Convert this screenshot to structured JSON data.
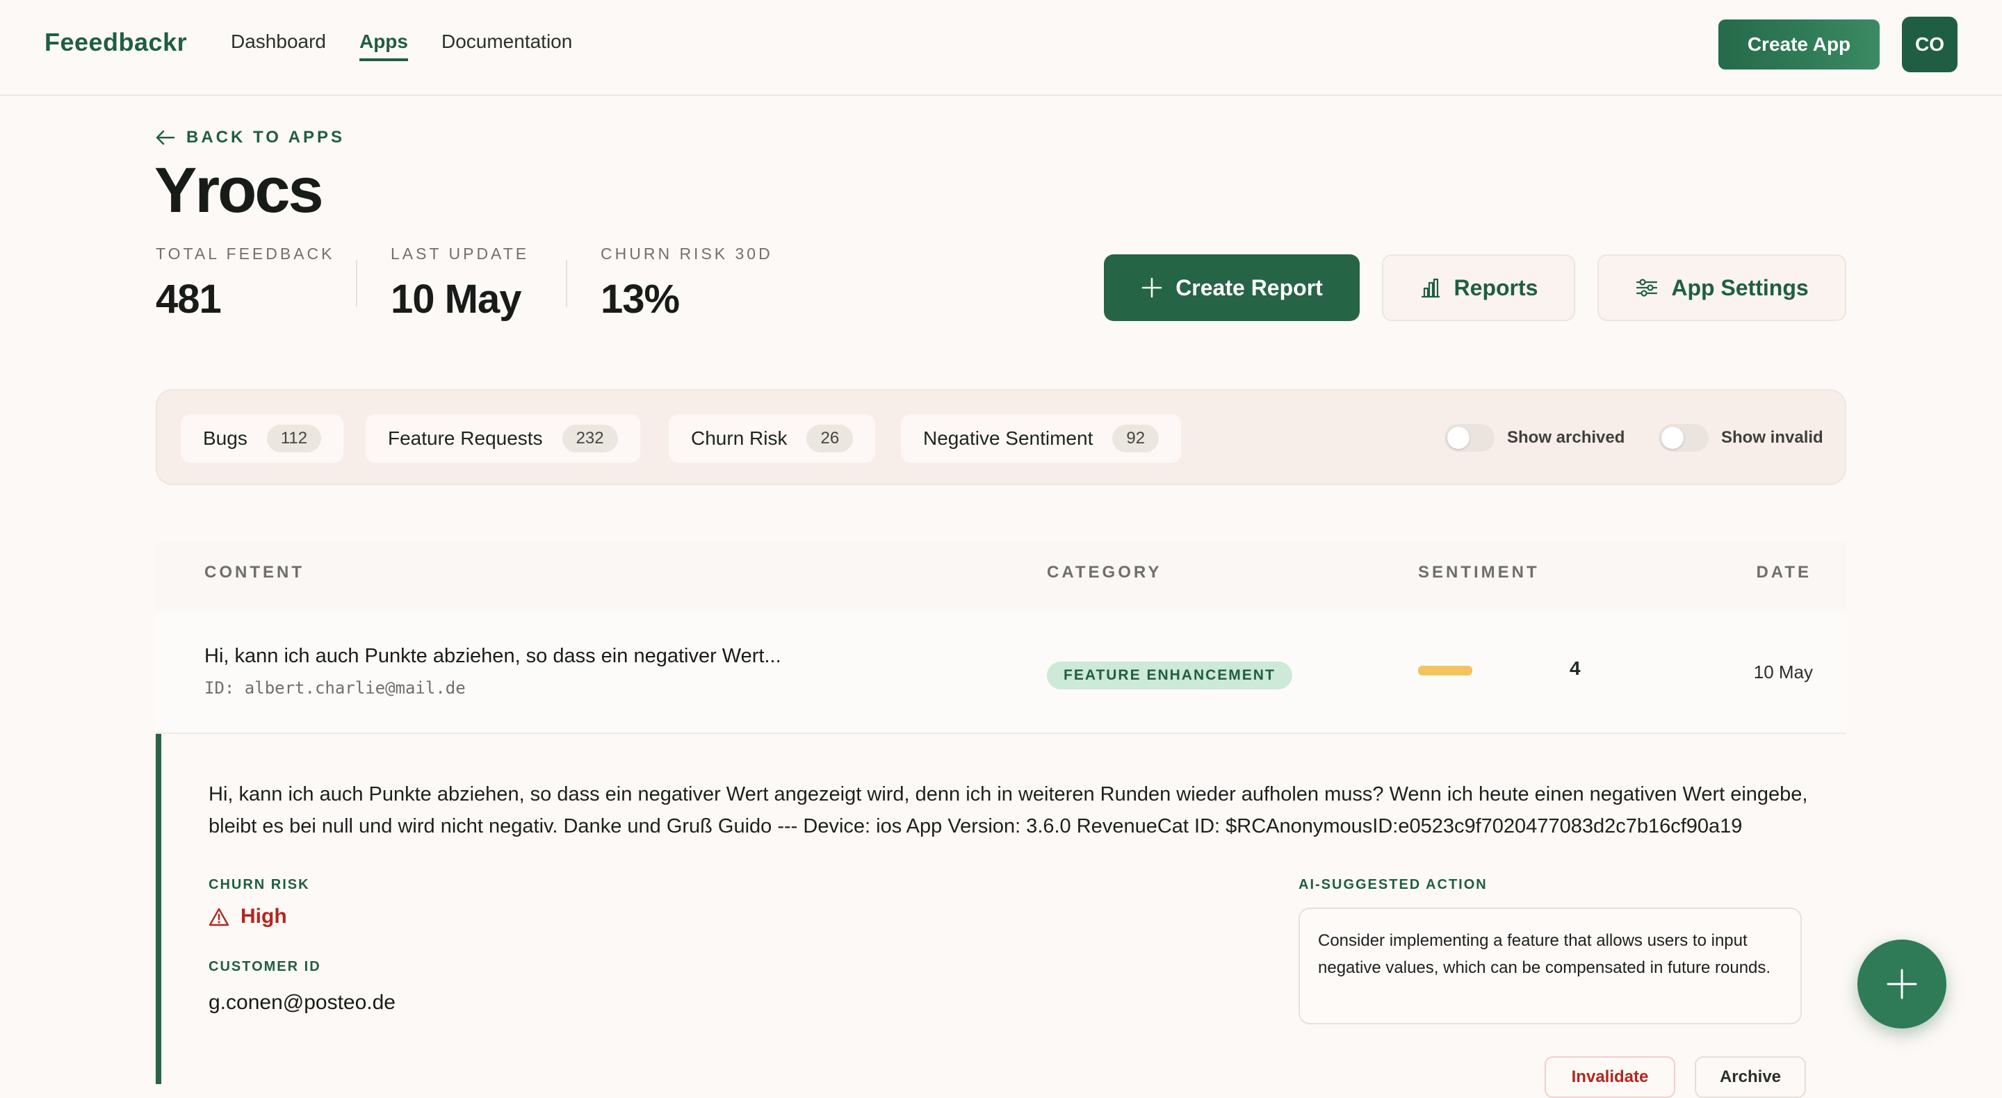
{
  "header": {
    "brand": "Feeedbackr",
    "nav": [
      "Dashboard",
      "Apps",
      "Documentation"
    ],
    "active_nav": "Apps",
    "create_app_label": "Create App",
    "avatar_initials": "CO"
  },
  "page": {
    "back_label": "BACK TO APPS",
    "title": "Yrocs",
    "stats": [
      {
        "label": "TOTAL FEEDBACK",
        "value": "481"
      },
      {
        "label": "LAST UPDATE",
        "value": "10 May"
      },
      {
        "label": "CHURN RISK 30D",
        "value": "13%"
      }
    ],
    "actions": {
      "create_report": "Create Report",
      "reports": "Reports",
      "app_settings": "App Settings"
    }
  },
  "filters": {
    "chips": [
      {
        "label": "Bugs",
        "count": "112"
      },
      {
        "label": "Feature Requests",
        "count": "232"
      },
      {
        "label": "Churn Risk",
        "count": "26"
      },
      {
        "label": "Negative Sentiment",
        "count": "92"
      }
    ],
    "show_archived": "Show archived",
    "show_invalid": "Show invalid"
  },
  "table": {
    "headers": {
      "content": "CONTENT",
      "category": "CATEGORY",
      "sentiment": "SENTIMENT",
      "date": "DATE"
    },
    "rows": [
      {
        "content": "Hi, kann ich auch Punkte abziehen, so dass ein negativer Wert...",
        "user_id": "ID: albert.charlie@mail.de",
        "category": "FEATURE ENHANCEMENT",
        "sentiment": "4",
        "date": "10 May"
      }
    ]
  },
  "detail": {
    "full_text": "Hi, kann ich auch Punkte abziehen, so dass ein negativer Wert angezeigt wird, denn ich in weiteren Runden wieder aufholen muss? Wenn ich heute einen negativen Wert eingebe, bleibt es bei null und wird nicht negativ. Danke und Gruß Guido --- Device: ios App Version: 3.6.0 RevenueCat ID: $RCAnonymousID:e0523c9f7020477083d2c7b16cf90a19",
    "churn_risk_label": "CHURN RISK",
    "churn_risk_value": "High",
    "customer_id_label": "CUSTOMER ID",
    "customer_id": "g.conen@posteo.de",
    "ai_label": "AI-SUGGESTED ACTION",
    "ai_text": "Consider implementing a feature that allows users to input negative values, which can be compensated in future rounds.",
    "invalidate_label": "Invalidate",
    "archive_label": "Archive"
  },
  "colors": {
    "primary": "#266446",
    "danger": "#b3261e",
    "sentiment_bar": "#f4c35e"
  }
}
